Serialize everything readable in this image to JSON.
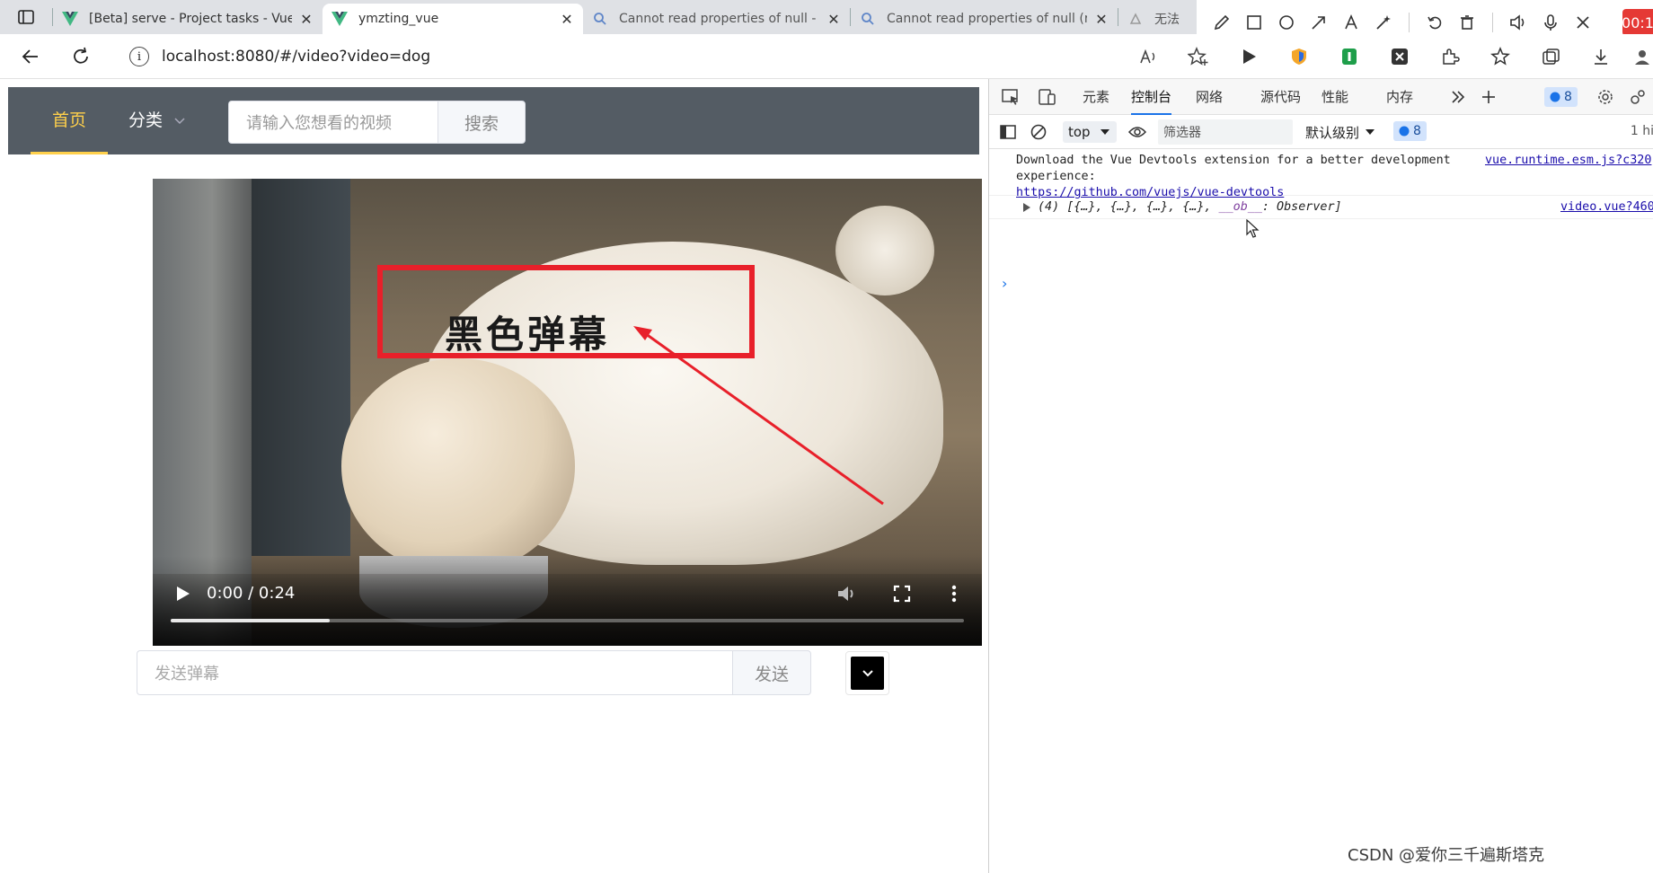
{
  "browser": {
    "tabs": [
      {
        "title": "[Beta] serve - Project tasks - Vue",
        "icon": "vue-icon",
        "active": false
      },
      {
        "title": "ymzting_vue",
        "icon": "vue-icon",
        "active": true
      },
      {
        "title": "Cannot read properties of null - ",
        "icon": "search-icon",
        "active": false
      },
      {
        "title": "Cannot read properties of null (r",
        "icon": "search-icon",
        "active": false
      },
      {
        "title": "无法",
        "icon": "extension-icon",
        "active": false
      }
    ],
    "url": "localhost:8080/#/video?video=dog",
    "record_timer": "00:1",
    "colors": {
      "tabstrip": "#dfe1e5",
      "accent": "#1a73e8",
      "record": "#e53935"
    }
  },
  "page": {
    "nav": {
      "home": "首页",
      "category": "分类",
      "search_placeholder": "请输入您想看的视频",
      "search_button": "搜索",
      "active_color": "#ffd04b",
      "bg_color": "#545c64"
    },
    "video": {
      "danmaku_text": "黑色弹幕",
      "time": "0:00 / 0:24",
      "progress": 0.2
    },
    "danmu": {
      "placeholder": "发送弹幕",
      "send_button": "发送",
      "selected_color": "#000000"
    }
  },
  "devtools": {
    "tabs": [
      "元素",
      "控制台",
      "网络",
      "源代码",
      "性能",
      "内存"
    ],
    "active_tab": "控制台",
    "message_count": "8",
    "context": "top",
    "filter_placeholder": "筛选器",
    "level": "默认级别",
    "issues_count": "8",
    "hidden_label": "1 hi",
    "logs": [
      {
        "line1": "Download the Vue Devtools extension for a better development",
        "line2": "experience:",
        "link": "https://github.com/vuejs/vue-devtools",
        "source": "vue.runtime.esm.js?c320"
      },
      {
        "preview_start": "(4) [{…}, {…}, {…}, {…}, ",
        "preview_ob": "__ob__",
        "preview_end": ": Observer]",
        "source": "video.vue?460"
      }
    ]
  },
  "watermark": "CSDN @爱你三千遍斯塔克"
}
